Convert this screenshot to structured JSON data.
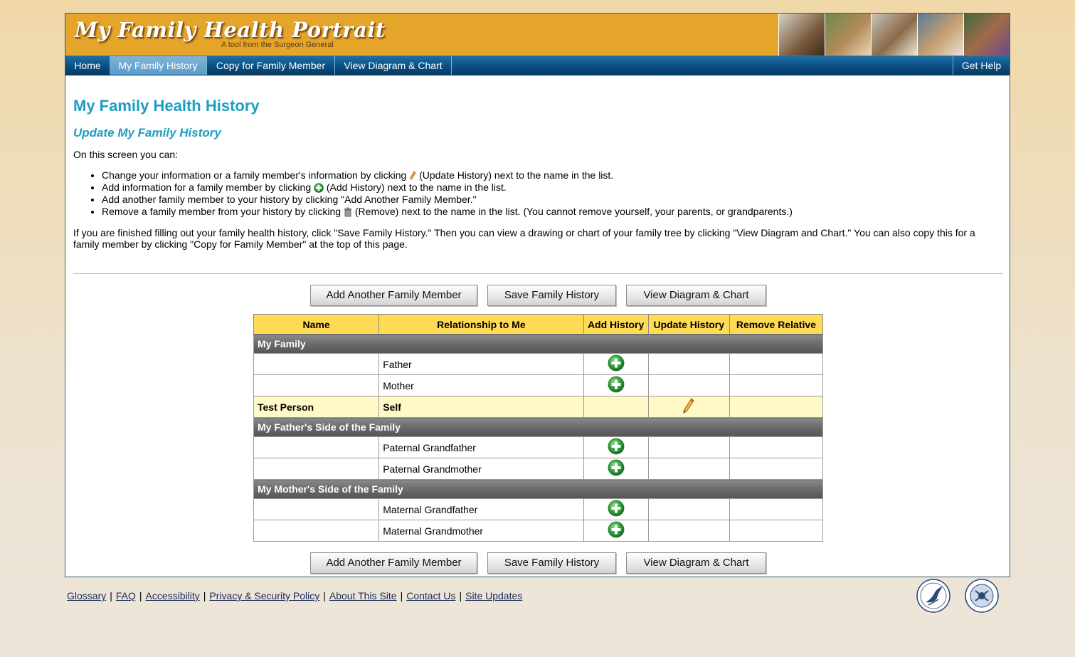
{
  "banner": {
    "title": "My Family Health Portrait",
    "subtitle": "A tool from the Surgeon General"
  },
  "nav": {
    "items": [
      "Home",
      "My Family History",
      "Copy for Family Member",
      "View Diagram & Chart"
    ],
    "active": "My Family History",
    "help": "Get Help"
  },
  "page": {
    "title": "My Family Health History",
    "subtitle": "Update My Family History",
    "intro": "On this screen you can:",
    "bullets": {
      "b1_pre": "Change your information or a family member's information by clicking",
      "b1_post": "(Update History) next to the name in the list.",
      "b2_pre": "Add information for a family member by clicking",
      "b2_post": "(Add History) next to the name in the list.",
      "b3": "Add another family member to your history by clicking \"Add Another Family Member.\"",
      "b4_pre": "Remove a family member from your history by clicking",
      "b4_post": "(Remove) next to the name in the list. (You cannot remove yourself, your parents, or grandparents.)"
    },
    "paragraph": "If you are finished filling out your family health history, click \"Save Family History.\" Then you can view a drawing or chart of your family tree by clicking \"View Diagram and Chart.\" You can also copy this for a family member by clicking \"Copy for Family Member\" at the top of this page."
  },
  "buttons": {
    "add_member": "Add Another Family Member",
    "save": "Save Family History",
    "view": "View Diagram & Chart"
  },
  "table": {
    "headers": {
      "name": "Name",
      "relationship": "Relationship to Me",
      "add": "Add History",
      "update": "Update History",
      "remove": "Remove Relative"
    },
    "groups": {
      "my_family": "My Family",
      "fathers_side": "My Father's Side of the Family",
      "mothers_side": "My Mother's Side of the Family"
    },
    "rows": {
      "father": {
        "name": "",
        "relationship": "Father"
      },
      "mother": {
        "name": "",
        "relationship": "Mother"
      },
      "self": {
        "name": "Test Person",
        "relationship": "Self"
      },
      "pat_gf": {
        "name": "",
        "relationship": "Paternal Grandfather"
      },
      "pat_gm": {
        "name": "",
        "relationship": "Paternal Grandmother"
      },
      "mat_gf": {
        "name": "",
        "relationship": "Maternal Grandfather"
      },
      "mat_gm": {
        "name": "",
        "relationship": "Maternal Grandmother"
      }
    }
  },
  "footer": {
    "glossary": "Glossary",
    "faq": "FAQ",
    "accessibility": "Accessibility",
    "privacy": "Privacy & Security Policy",
    "about": "About This Site",
    "contact": "Contact Us",
    "updates": "Site Updates",
    "separator": "|"
  },
  "icons": {
    "add": "plus-circle-icon",
    "update": "pencil-icon",
    "remove": "trash-icon"
  },
  "colors": {
    "title_blue": "#1e9dc2",
    "banner_orange": "#e5a52a",
    "nav_blue": "#0a4f82",
    "header_yellow": "#ffdb55",
    "self_row": "#fff9c8",
    "add_green": "#2e9e3c"
  }
}
